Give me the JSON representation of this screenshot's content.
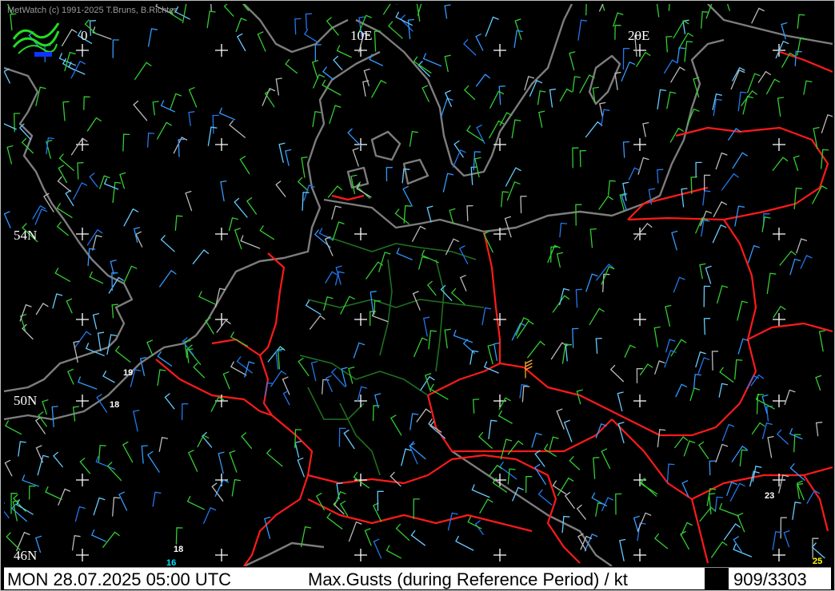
{
  "app": {
    "copyright": "MetWatch  (c) 1991-2025 T.Bruns, B.Richter"
  },
  "lon_labels": [
    {
      "text": "0",
      "lon": 0
    },
    {
      "text": "10E",
      "lon": 10
    },
    {
      "text": "20E",
      "lon": 20
    }
  ],
  "lat_labels": [
    {
      "text": "54N",
      "lat": 54
    },
    {
      "text": "50N",
      "lat": 50
    },
    {
      "text": "46N",
      "lat": 46
    }
  ],
  "station_values": [
    {
      "text": "19",
      "color": "#ffffff"
    },
    {
      "text": "18",
      "color": "#ffffff"
    },
    {
      "text": "18",
      "color": "#ffffff"
    },
    {
      "text": "16",
      "color": "#00e5ff"
    },
    {
      "text": "23",
      "color": "#ffffff"
    },
    {
      "text": "25",
      "color": "#ffff00"
    }
  ],
  "colors": {
    "background": "#000000",
    "borders": "#ff1a1a",
    "coast": "#7d7d7d",
    "german_states": "#1f6f1f",
    "grid": "#ffffff"
  },
  "status": {
    "datetime": "MON 28.07.2025 05:00 UTC",
    "product": "Max.Gusts (during Reference Period) / kt",
    "counter": "909/3303"
  }
}
